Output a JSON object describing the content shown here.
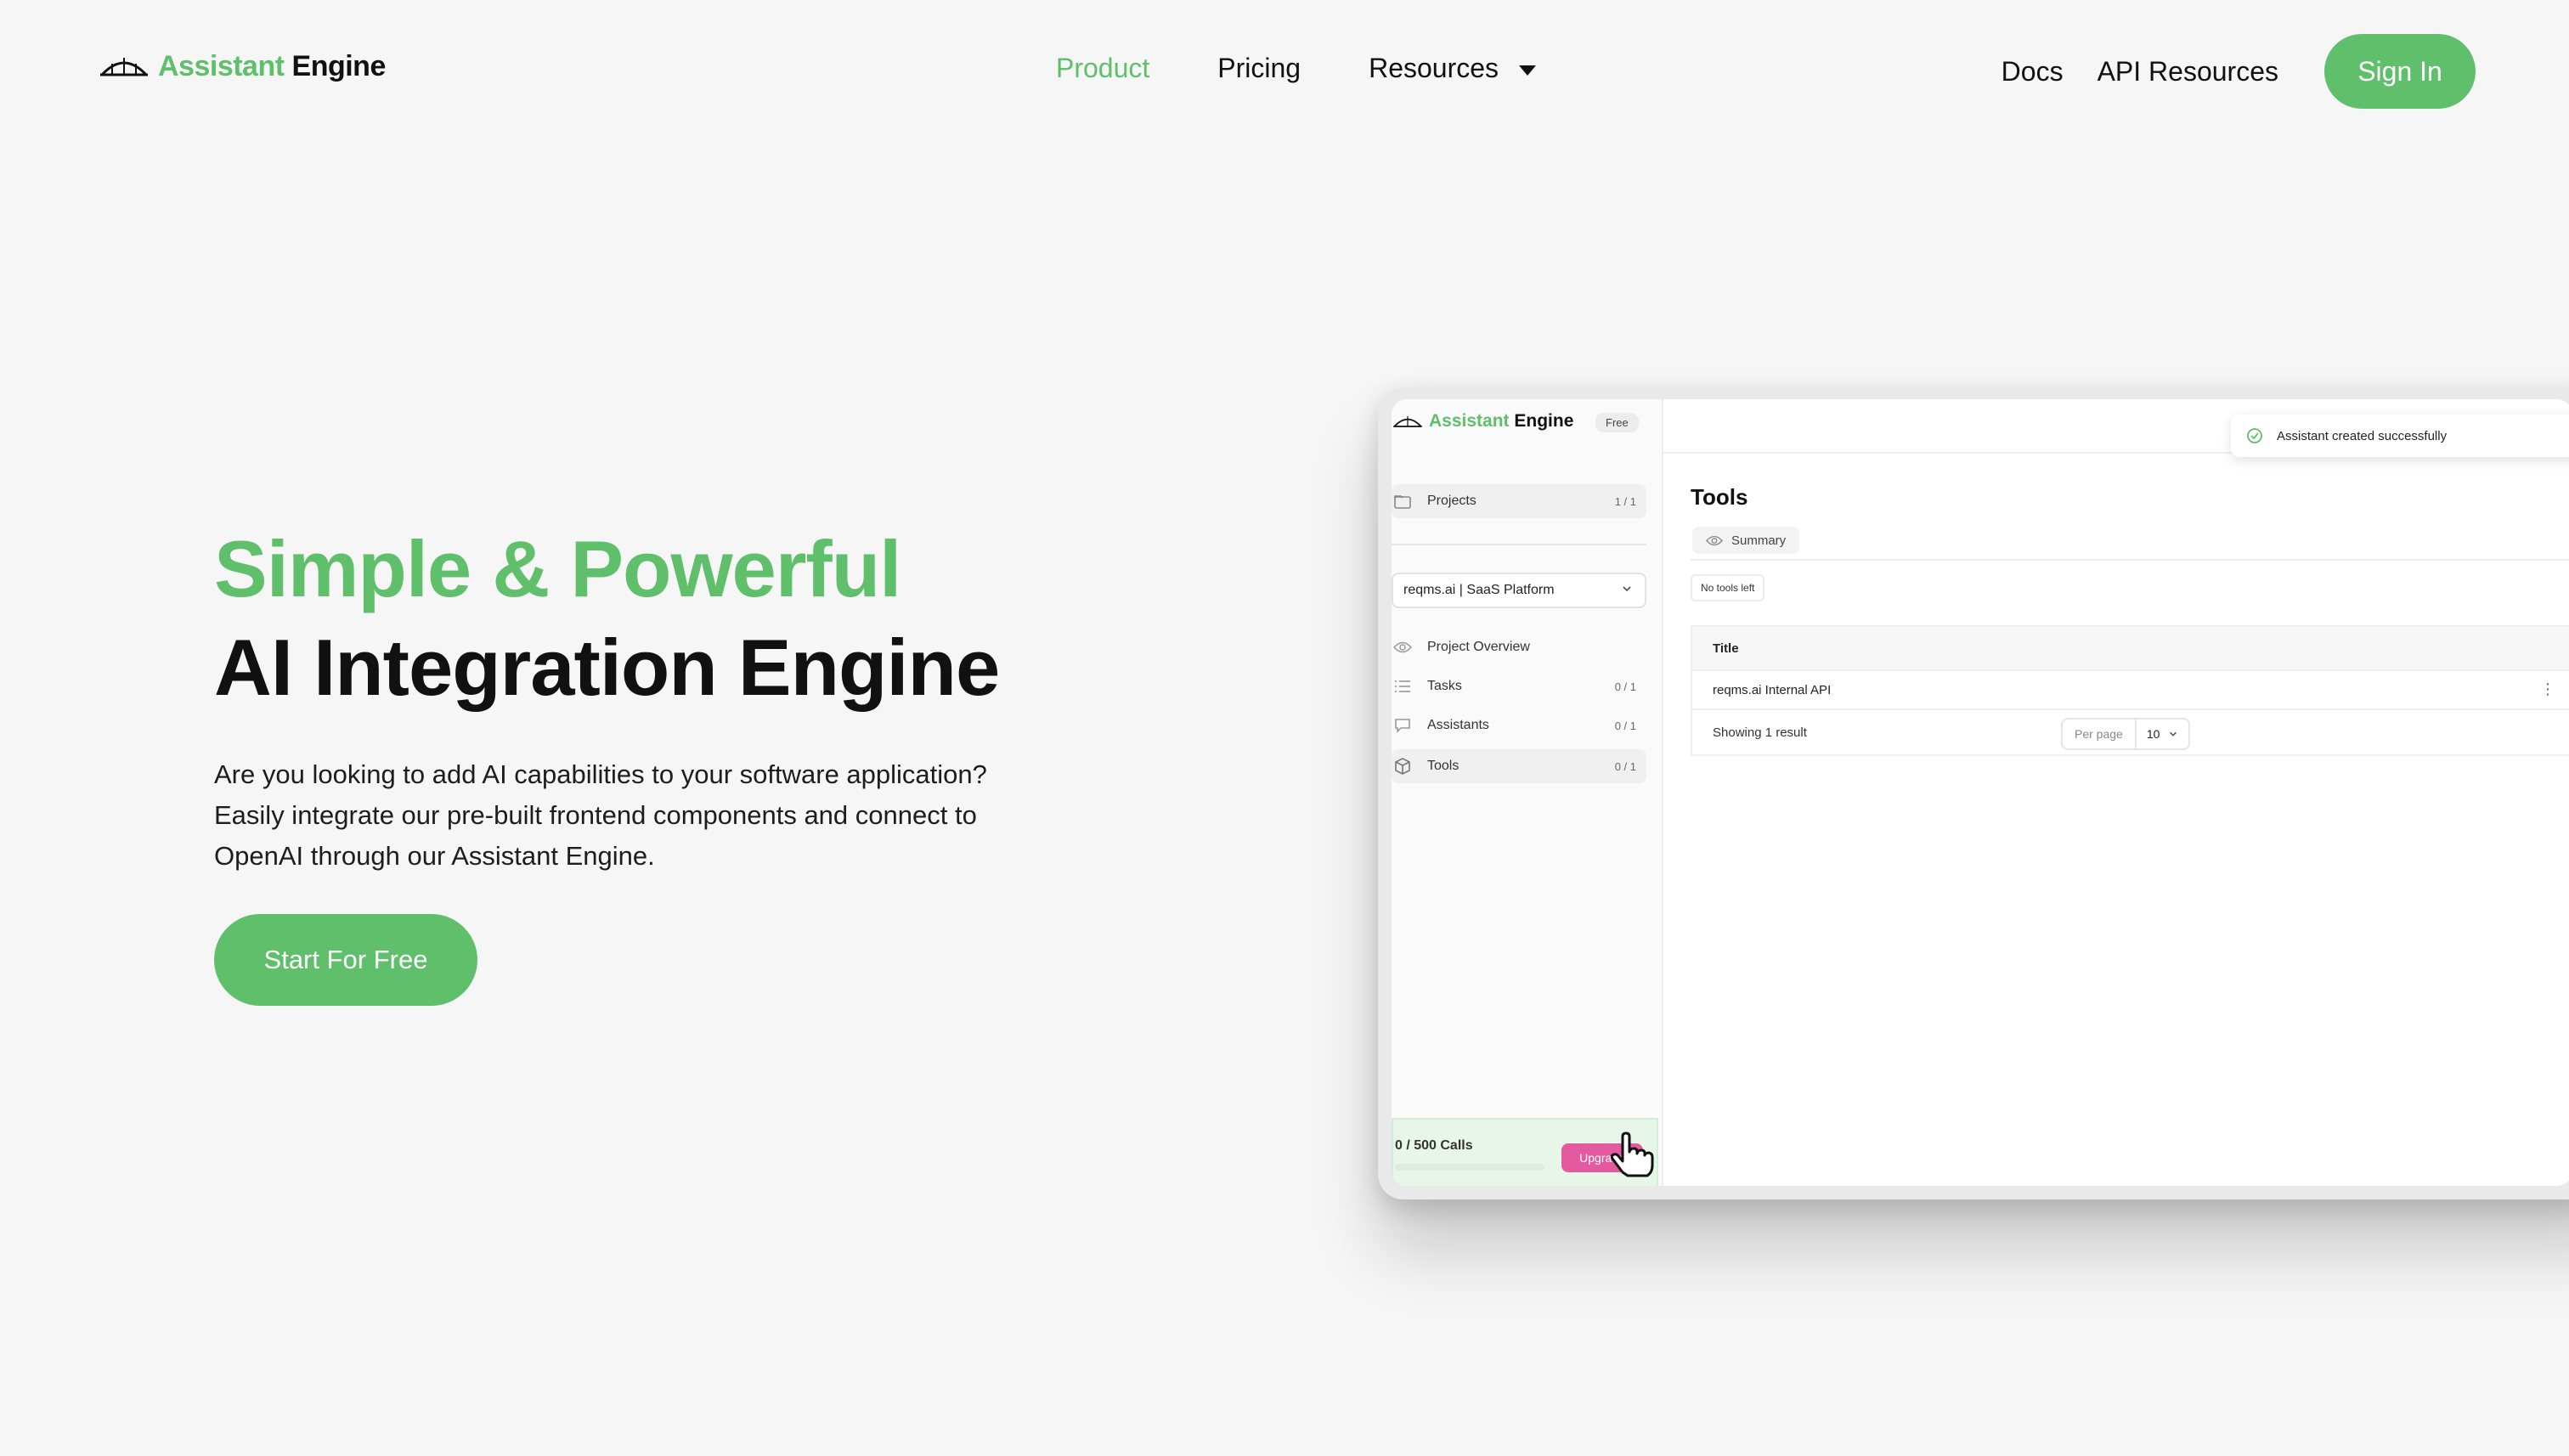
{
  "nav": {
    "brand_part1": "Assistant",
    "brand_part2": "Engine",
    "items": [
      {
        "label": "Product"
      },
      {
        "label": "Pricing"
      },
      {
        "label": "Resources"
      }
    ],
    "docs": "Docs",
    "api_resources": "API Resources",
    "signin": "Sign In"
  },
  "hero": {
    "title_line1": "Simple & Powerful",
    "title_line2": "AI Integration Engine",
    "description": "Are you looking to add AI capabilities to your software application? Easily integrate our pre-built frontend components and connect to OpenAI through our Assistant Engine.",
    "cta": "Start For Free"
  },
  "app": {
    "brand_part1": "Assistant",
    "brand_part2": "Engine",
    "plan_badge": "Free",
    "projects": {
      "label": "Projects",
      "count": "1 / 1"
    },
    "project_select": "reqms.ai | SaaS Platform",
    "menu": [
      {
        "label": "Project Overview",
        "count": "",
        "icon": "eye-icon"
      },
      {
        "label": "Tasks",
        "count": "0 / 1",
        "icon": "list-icon"
      },
      {
        "label": "Assistants",
        "count": "0 / 1",
        "icon": "chat-icon"
      },
      {
        "label": "Tools",
        "count": "0 / 1",
        "icon": "cube-icon"
      }
    ],
    "usage": {
      "calls": "0 / 500 Calls",
      "fraction": 0,
      "upgrade": "Upgrade"
    },
    "toast": "Assistant created successfully",
    "page_title": "Tools",
    "tab": "Summary",
    "no_tools": "No tools left",
    "table": {
      "header": "Title",
      "rows": [
        {
          "title": "reqms.ai Internal API"
        }
      ],
      "showing": "Showing 1 result",
      "per_page_label": "Per page",
      "per_page_value": "10"
    }
  },
  "colors": {
    "accent": "#5fbf6a",
    "upgrade": "#e45aa0"
  }
}
